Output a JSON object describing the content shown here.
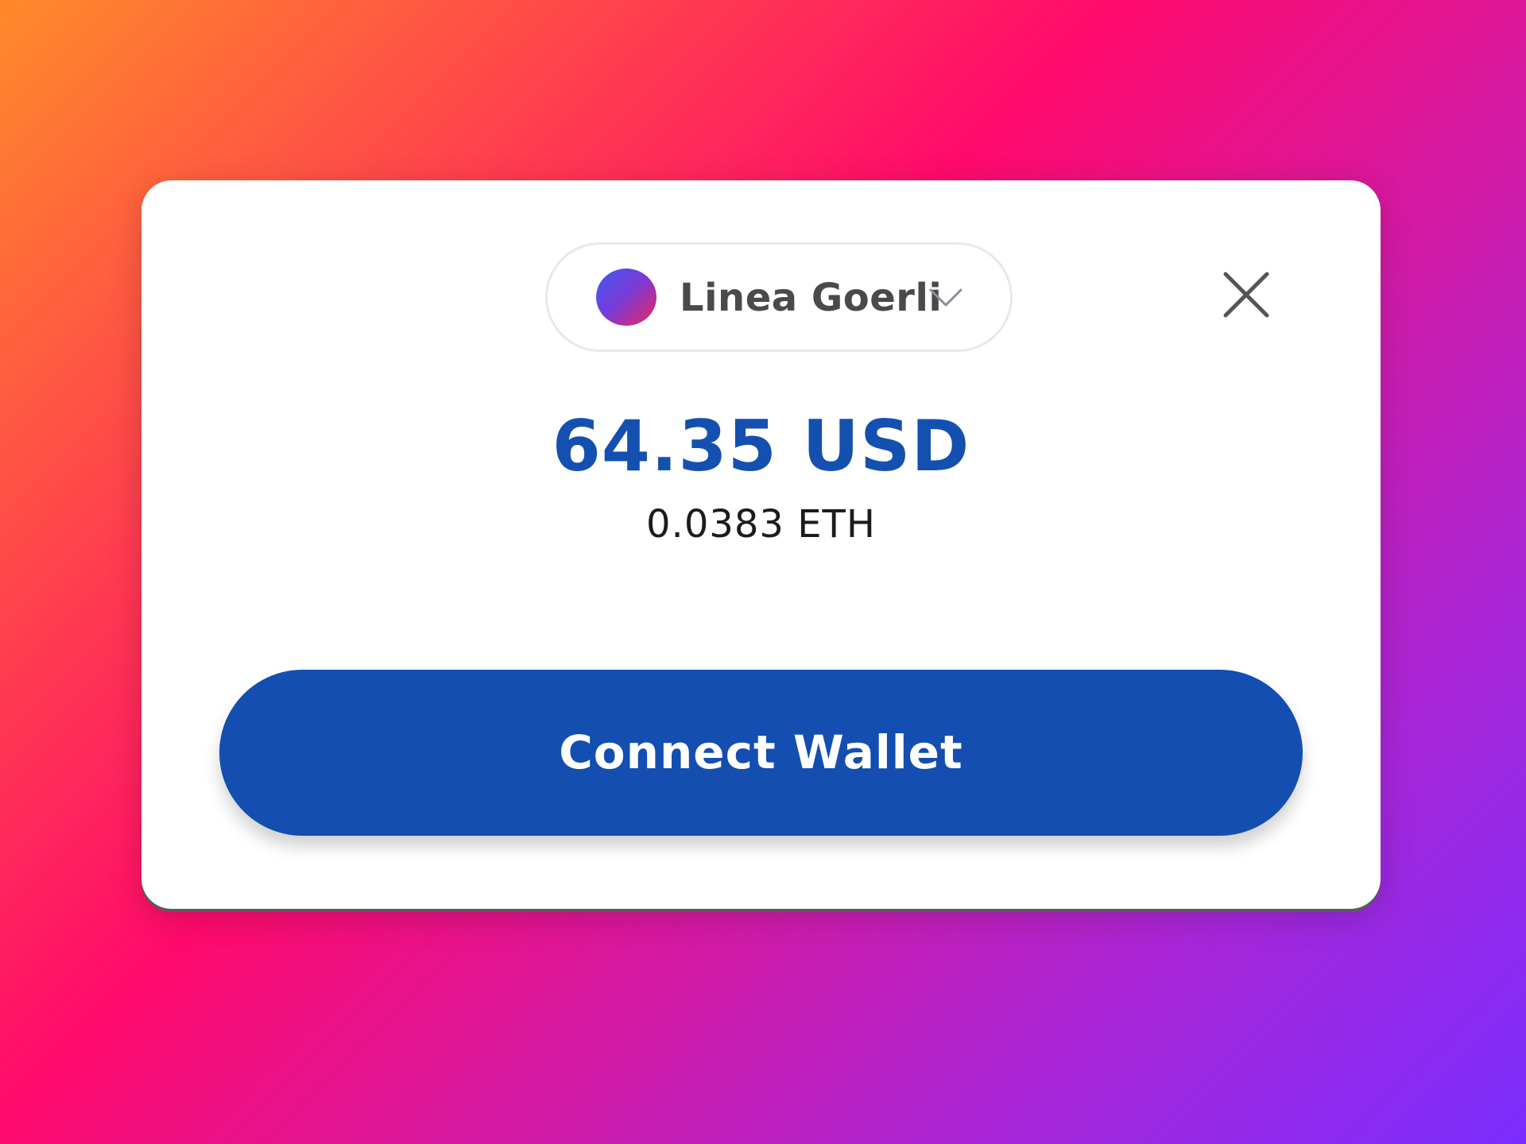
{
  "network_selector": {
    "label": "Linea Goerli",
    "icon": "network-gradient-icon",
    "dropdown_icon": "chevron-down-icon"
  },
  "close": {
    "icon": "close-icon"
  },
  "balance": {
    "usd": "64.35 USD",
    "eth": "0.0383 ETH"
  },
  "actions": {
    "connect_label": "Connect Wallet"
  },
  "colors": {
    "primary": "#134eb0",
    "balance_text": "#1450b0",
    "card_background": "#ffffff"
  }
}
